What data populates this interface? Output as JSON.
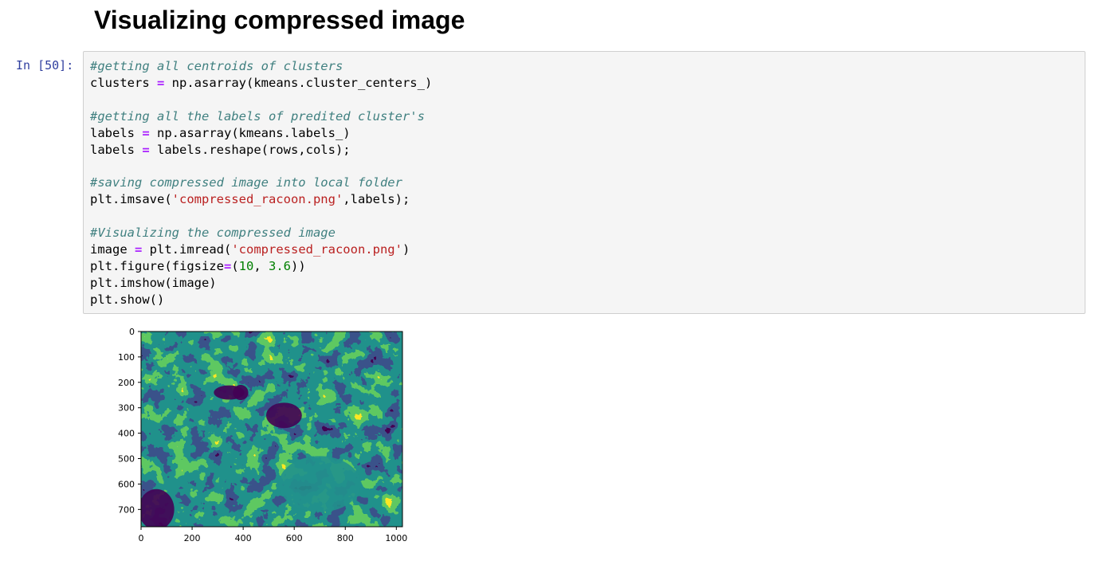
{
  "heading": "Visualizing compressed image",
  "cell": {
    "prompt": "In [50]:",
    "lines": [
      {
        "tokens": [
          {
            "t": "cmt",
            "v": "#getting all centroids of clusters"
          }
        ]
      },
      {
        "tokens": [
          {
            "t": "plain",
            "v": "clusters "
          },
          {
            "t": "op",
            "v": "="
          },
          {
            "t": "plain",
            "v": " np.asarray(kmeans.cluster_centers_)"
          }
        ]
      },
      {
        "tokens": []
      },
      {
        "tokens": [
          {
            "t": "cmt",
            "v": "#getting all the labels of predited cluster's"
          }
        ]
      },
      {
        "tokens": [
          {
            "t": "plain",
            "v": "labels "
          },
          {
            "t": "op",
            "v": "="
          },
          {
            "t": "plain",
            "v": " np.asarray(kmeans.labels_)"
          }
        ]
      },
      {
        "tokens": [
          {
            "t": "plain",
            "v": "labels "
          },
          {
            "t": "op",
            "v": "="
          },
          {
            "t": "plain",
            "v": " labels.reshape(rows,cols);"
          }
        ]
      },
      {
        "tokens": []
      },
      {
        "tokens": [
          {
            "t": "cmt",
            "v": "#saving compressed image into local folder"
          }
        ]
      },
      {
        "tokens": [
          {
            "t": "plain",
            "v": "plt.imsave("
          },
          {
            "t": "str",
            "v": "'compressed_racoon.png'"
          },
          {
            "t": "plain",
            "v": ",labels);"
          }
        ]
      },
      {
        "tokens": []
      },
      {
        "tokens": [
          {
            "t": "cmt",
            "v": "#Visualizing the compressed image"
          }
        ]
      },
      {
        "tokens": [
          {
            "t": "plain",
            "v": "image "
          },
          {
            "t": "op",
            "v": "="
          },
          {
            "t": "plain",
            "v": " plt.imread("
          },
          {
            "t": "str",
            "v": "'compressed_racoon.png'"
          },
          {
            "t": "plain",
            "v": ")"
          }
        ]
      },
      {
        "tokens": [
          {
            "t": "plain",
            "v": "plt.figure(figsize"
          },
          {
            "t": "op",
            "v": "="
          },
          {
            "t": "plain",
            "v": "("
          },
          {
            "t": "num",
            "v": "10"
          },
          {
            "t": "plain",
            "v": ", "
          },
          {
            "t": "num",
            "v": "3.6"
          },
          {
            "t": "plain",
            "v": "))"
          }
        ]
      },
      {
        "tokens": [
          {
            "t": "plain",
            "v": "plt.imshow(image)"
          }
        ]
      },
      {
        "tokens": [
          {
            "t": "plain",
            "v": "plt.show()"
          }
        ]
      }
    ]
  },
  "output_plot": {
    "x_ticks": [
      "0",
      "200",
      "400",
      "600",
      "800",
      "1000"
    ],
    "y_ticks": [
      "0",
      "100",
      "200",
      "300",
      "400",
      "500",
      "600",
      "700"
    ],
    "x_tick_values": [
      0,
      200,
      400,
      600,
      800,
      1000
    ],
    "y_tick_values": [
      0,
      100,
      200,
      300,
      400,
      500,
      600,
      700
    ],
    "x_range": [
      0,
      1024
    ],
    "y_range": [
      0,
      768
    ],
    "palette": [
      "#440154",
      "#3b528b",
      "#21918c",
      "#5ec962",
      "#fde725"
    ]
  }
}
